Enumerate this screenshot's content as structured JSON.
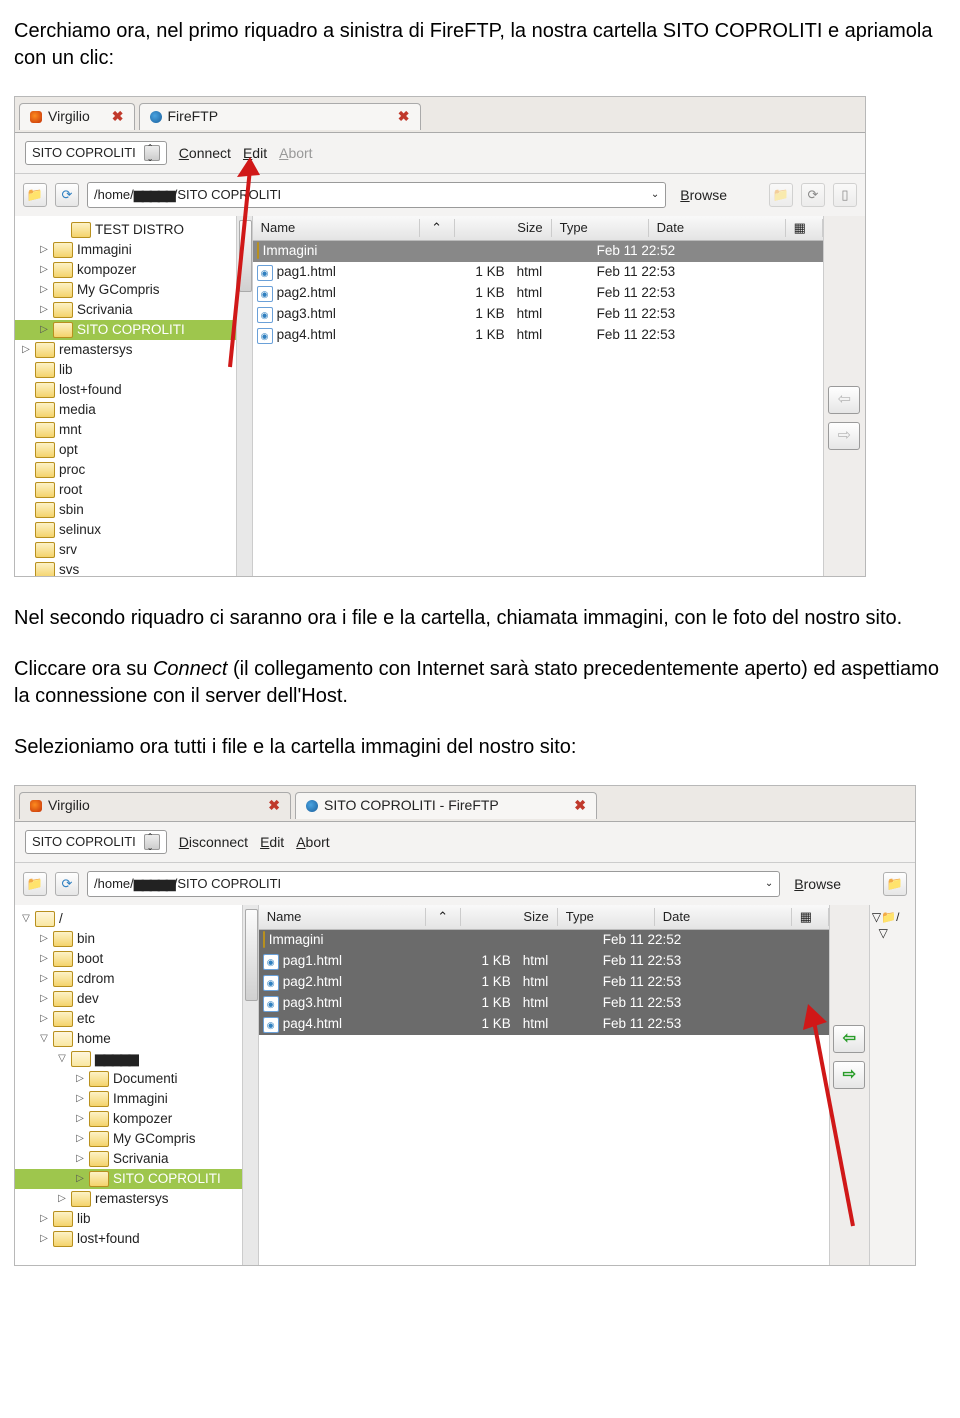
{
  "para1a": "Cerchiamo ora, nel primo riquadro a sinistra di FireFTP, la nostra cartella SITO COPROLITI e apriamola con un  clic:",
  "shot1": {
    "tab1": "Virgilio",
    "tab2": "FireFTP",
    "account": "SITO COPROLITI",
    "connect": "Connect",
    "edit": "Edit",
    "abort": "Abort",
    "path_pre": "/home/",
    "path_mask": "▆▆▆▆▆",
    "path_post": "/SITO COPROLITI",
    "browse": "Browse",
    "tree": [
      {
        "ind": 2,
        "tw": "",
        "name": "TEST DISTRO"
      },
      {
        "ind": 1,
        "tw": "▷",
        "name": "Immagini"
      },
      {
        "ind": 1,
        "tw": "▷",
        "name": "kompozer"
      },
      {
        "ind": 1,
        "tw": "▷",
        "name": "My GCompris"
      },
      {
        "ind": 1,
        "tw": "▷",
        "name": "Scrivania"
      },
      {
        "ind": 1,
        "tw": "▷",
        "name": "SITO COPROLITI",
        "sel": true
      },
      {
        "ind": 0,
        "tw": "▷",
        "name": "remastersys"
      },
      {
        "ind": 0,
        "tw": "",
        "name": "lib"
      },
      {
        "ind": 0,
        "tw": "",
        "name": "lost+found"
      },
      {
        "ind": 0,
        "tw": "",
        "name": "media"
      },
      {
        "ind": 0,
        "tw": "",
        "name": "mnt"
      },
      {
        "ind": 0,
        "tw": "",
        "name": "opt"
      },
      {
        "ind": 0,
        "tw": "",
        "name": "proc"
      },
      {
        "ind": 0,
        "tw": "",
        "name": "root"
      },
      {
        "ind": 0,
        "tw": "",
        "name": "sbin"
      },
      {
        "ind": 0,
        "tw": "",
        "name": "selinux"
      },
      {
        "ind": 0,
        "tw": "",
        "name": "srv"
      },
      {
        "ind": 0,
        "tw": "",
        "name": "svs"
      }
    ],
    "cols": {
      "name": "Name",
      "size": "Size",
      "type": "Type",
      "date": "Date"
    },
    "files": [
      {
        "folder": true,
        "name": "Immagini",
        "size": "",
        "type": "",
        "date": "Feb 11 22:52",
        "sel": true
      },
      {
        "name": "pag1.html",
        "size": "1 KB",
        "type": "html",
        "date": "Feb 11 22:53"
      },
      {
        "name": "pag2.html",
        "size": "1 KB",
        "type": "html",
        "date": "Feb 11 22:53"
      },
      {
        "name": "pag3.html",
        "size": "1 KB",
        "type": "html",
        "date": "Feb 11 22:53"
      },
      {
        "name": "pag4.html",
        "size": "1 KB",
        "type": "html",
        "date": "Feb 11 22:53"
      }
    ]
  },
  "para2a": "Nel secondo riquadro ci saranno ora i file e la cartella, chiamata immagini, con le foto del nostro sito.",
  "para2b_pre": "Cliccare ora su ",
  "para2b_it": "Connect",
  "para2b_post": " (il collegamento con Internet sarà stato precedentemente aperto) ed aspettiamo la connessione con il server dell'Host.",
  "para3": "Selezioniamo ora tutti i file e la cartella immagini del nostro sito:",
  "shot2": {
    "tab1": "Virgilio",
    "tab2": "SITO COPROLITI - FireFTP",
    "account": "SITO COPROLITI",
    "disconnect": "Disconnect",
    "edit": "Edit",
    "abort": "Abort",
    "path_pre": "/home/",
    "path_mask": "▆▆▆▆▆",
    "path_post": "/SITO COPROLITI",
    "browse": "Browse",
    "root": "/",
    "tree": [
      {
        "ind": 0,
        "tw": "▽",
        "name": "/",
        "open": true
      },
      {
        "ind": 1,
        "tw": "▷",
        "name": "bin"
      },
      {
        "ind": 1,
        "tw": "▷",
        "name": "boot"
      },
      {
        "ind": 1,
        "tw": "▷",
        "name": "cdrom"
      },
      {
        "ind": 1,
        "tw": "▷",
        "name": "dev"
      },
      {
        "ind": 1,
        "tw": "▷",
        "name": "etc"
      },
      {
        "ind": 1,
        "tw": "▽",
        "name": "home",
        "open": true
      },
      {
        "ind": 2,
        "tw": "▽",
        "name": "▆▆▆▆▆",
        "open": true,
        "mask": true
      },
      {
        "ind": 3,
        "tw": "▷",
        "name": "Documenti"
      },
      {
        "ind": 3,
        "tw": "▷",
        "name": "Immagini"
      },
      {
        "ind": 3,
        "tw": "▷",
        "name": "kompozer"
      },
      {
        "ind": 3,
        "tw": "▷",
        "name": "My GCompris"
      },
      {
        "ind": 3,
        "tw": "▷",
        "name": "Scrivania"
      },
      {
        "ind": 3,
        "tw": "▷",
        "name": "SITO COPROLITI",
        "sel": true
      },
      {
        "ind": 2,
        "tw": "▷",
        "name": "remastersys"
      },
      {
        "ind": 1,
        "tw": "▷",
        "name": "lib"
      },
      {
        "ind": 1,
        "tw": "▷",
        "name": "lost+found"
      }
    ],
    "cols": {
      "name": "Name",
      "size": "Size",
      "type": "Type",
      "date": "Date"
    },
    "files": [
      {
        "folder": true,
        "name": "Immagini",
        "size": "",
        "type": "",
        "date": "Feb 11 22:52",
        "sel": true
      },
      {
        "name": "pag1.html",
        "size": "1 KB",
        "type": "html",
        "date": "Feb 11 22:53",
        "sel": true
      },
      {
        "name": "pag2.html",
        "size": "1 KB",
        "type": "html",
        "date": "Feb 11 22:53",
        "sel": true
      },
      {
        "name": "pag3.html",
        "size": "1 KB",
        "type": "html",
        "date": "Feb 11 22:53",
        "sel": true
      },
      {
        "name": "pag4.html",
        "size": "1 KB",
        "type": "html",
        "date": "Feb 11 22:53",
        "sel": true
      }
    ]
  }
}
